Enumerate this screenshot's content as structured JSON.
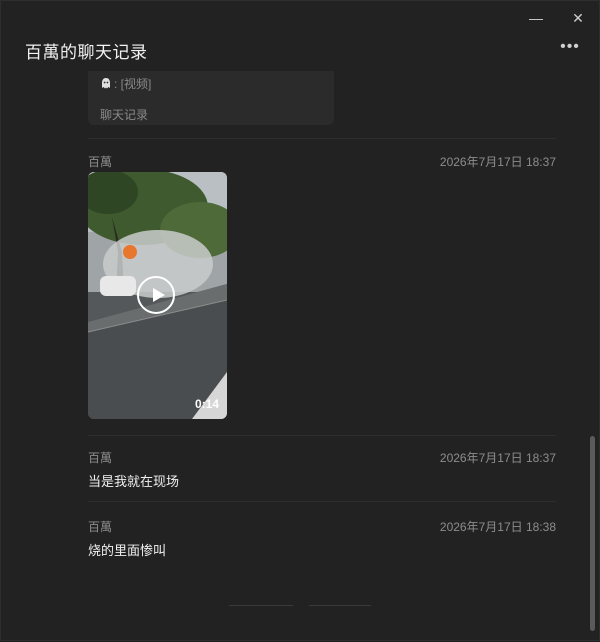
{
  "window": {
    "title": "百萬的聊天记录",
    "minimize_icon": "minimize-icon",
    "close_icon": "close-icon",
    "more_icon": "more-icon"
  },
  "card": {
    "preview": ": [视频]",
    "label": "聊天记录",
    "icon": "ghost-icon"
  },
  "messages": [
    {
      "sender": "百萬",
      "time": "2026年7月17日 18:37",
      "type": "video",
      "duration": "0:14"
    },
    {
      "sender": "百萬",
      "time": "2026年7月17日 18:37",
      "text": "当是我就在现场"
    },
    {
      "sender": "百萬",
      "time": "2026年7月17日 18:38",
      "text": "烧的里面惨叫"
    }
  ]
}
